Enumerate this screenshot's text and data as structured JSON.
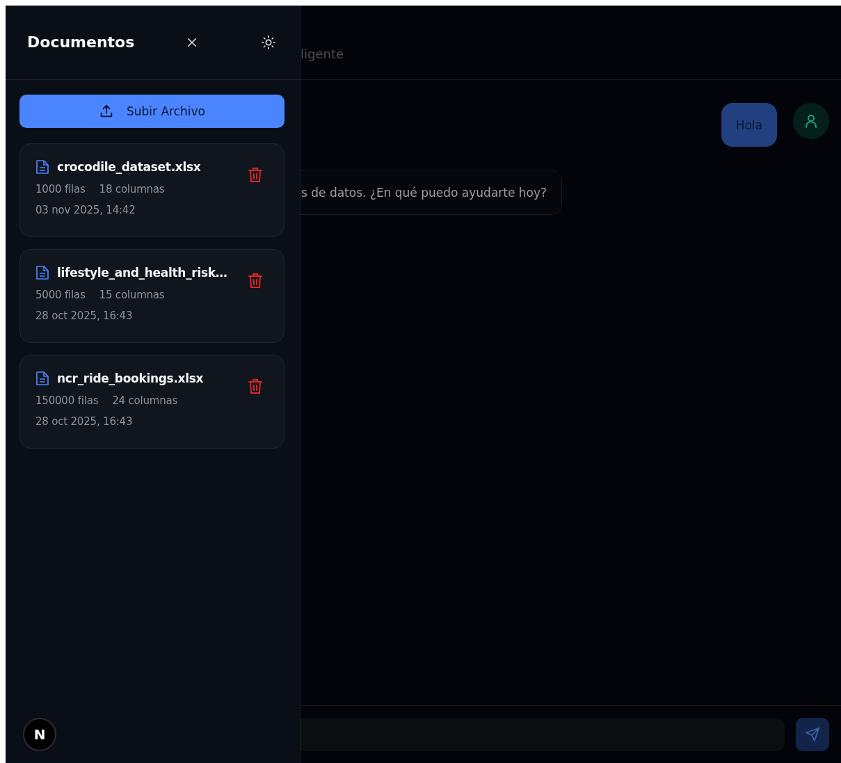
{
  "sidebar": {
    "title": "Documentos",
    "upload_button": "Subir Archivo",
    "documents": [
      {
        "name": "crocodile_dataset.xlsx",
        "rows": "1000 filas",
        "columns": "18 columnas",
        "date": "03 nov 2025, 14:42"
      },
      {
        "name": "lifestyle_and_health_risk…",
        "rows": "5000 filas",
        "columns": "15 columnas",
        "date": "28 oct 2025, 16:43"
      },
      {
        "name": "ncr_ride_bookings.xlsx",
        "rows": "150000 filas",
        "columns": "24 columnas",
        "date": "28 oct 2025, 16:43"
      }
    ],
    "logo": "N"
  },
  "main": {
    "header_title": "ligente",
    "messages": [
      {
        "kind": "user",
        "text": "Hola"
      },
      {
        "kind": "assistant",
        "text": "s de datos. ¿En qué puedo ayudarte hoy?"
      }
    ]
  }
}
